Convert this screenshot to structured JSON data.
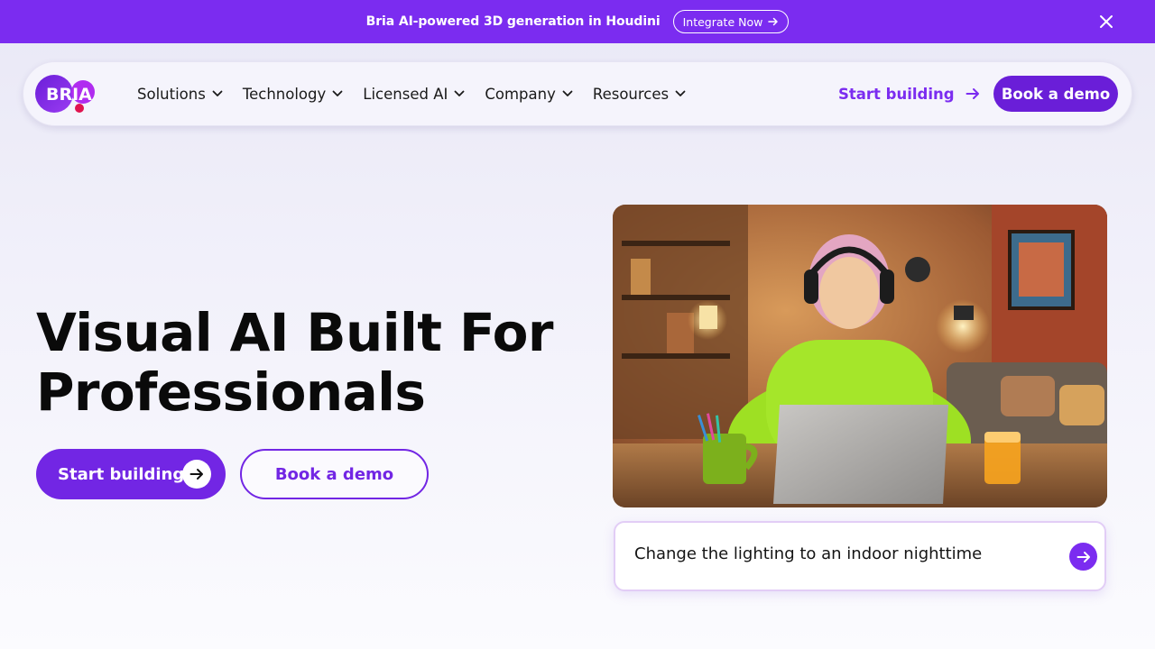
{
  "banner": {
    "text": "Bria AI-powered 3D generation in Houdini",
    "button_label": "Integrate Now",
    "button_icon": "arrow-right-icon",
    "close_icon": "close-icon",
    "background": "#7b2cf0"
  },
  "nav": {
    "logo_text": "BRIA",
    "menu": [
      {
        "label": "Solutions",
        "icon": "chevron-down-icon"
      },
      {
        "label": "Technology",
        "icon": "chevron-down-icon"
      },
      {
        "label": "Licensed AI",
        "icon": "chevron-down-icon"
      },
      {
        "label": "Company",
        "icon": "chevron-down-icon"
      },
      {
        "label": "Resources",
        "icon": "chevron-down-icon"
      }
    ],
    "start_building_label": "Start building",
    "book_demo_label": "Book a demo",
    "accent": "#7b2cf0",
    "button_color": "#6a1ed8"
  },
  "hero": {
    "title_line1": "Visual AI Built For",
    "title_line2": "Professionals",
    "primary_button_label": "Start building",
    "primary_button_icon": "arrow-right-icon",
    "secondary_button_label": "Book a demo"
  },
  "demo": {
    "image_subject": "woman-with-headphones-at-laptop-illustration",
    "prompt_text": "Change the lighting to an indoor nighttime",
    "send_icon": "arrow-right-icon"
  }
}
